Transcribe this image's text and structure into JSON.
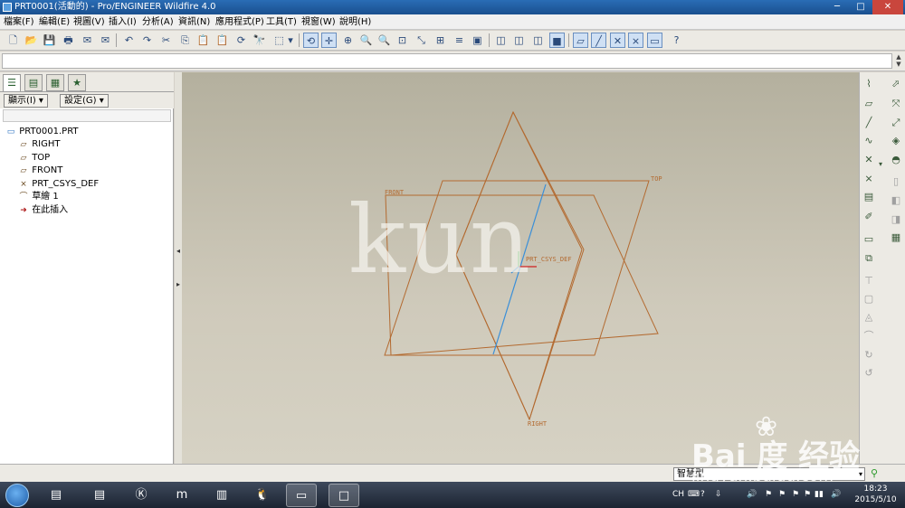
{
  "window": {
    "title": "PRT0001(活動的) - Pro/ENGINEER Wildfire 4.0"
  },
  "window_controls": {
    "minimize": "─",
    "maximize": "□",
    "close": "✕"
  },
  "menu": [
    {
      "label": "檔案(F)"
    },
    {
      "label": "編輯(E)"
    },
    {
      "label": "視圖(V)"
    },
    {
      "label": "插入(I)"
    },
    {
      "label": "分析(A)"
    },
    {
      "label": "資訊(N)"
    },
    {
      "label": "應用程式(P)"
    },
    {
      "label": "工具(T)"
    },
    {
      "label": "視窗(W)"
    },
    {
      "label": "說明(H)"
    }
  ],
  "toolbar": {
    "new": "🗋",
    "open": "📂",
    "save": "💾",
    "print": "🖶",
    "email": "✉",
    "email2": "✉",
    "undo": "↶",
    "redo": "↷",
    "cut": "✂",
    "copy": "⎘",
    "paste": "📋",
    "paste_special": "📋",
    "regenerate": "⟳",
    "find": "🔭",
    "select_box": "⬚",
    "dropdown": "▾",
    "repaint": "⟲",
    "spin_center": "✛",
    "orient": "⊕",
    "zoom_in": "🔍",
    "zoom_out": "🔍",
    "refit": "⊡",
    "reorient": "⤡",
    "saved_views": "⊞",
    "layers": "≡",
    "view_manager": "▣",
    "wireframe": "◫",
    "hidden_line": "◫",
    "no_hidden": "◫",
    "shading": "■",
    "datum_planes": "▱",
    "datum_axes": "╱",
    "datum_points": "✕",
    "coord_sys": "⨯",
    "annotations": "▭",
    "context_help": "?"
  },
  "message_area": {
    "scroll_up": "▲",
    "scroll_down": "▼"
  },
  "navigator": {
    "tabs": [
      "☰",
      "▤",
      "▦",
      "★"
    ],
    "show_button": "顯示(I) ▾",
    "settings_button": "設定(G) ▾",
    "tree": [
      {
        "label": "PRT0001.PRT",
        "icon": "▭"
      },
      {
        "label": "RIGHT",
        "icon": "▱"
      },
      {
        "label": "TOP",
        "icon": "▱"
      },
      {
        "label": "FRONT",
        "icon": "▱"
      },
      {
        "label": "PRT_CSYS_DEF",
        "icon": "⨯"
      },
      {
        "label": "草繪 1",
        "icon": "⌒"
      },
      {
        "label": "在此插入",
        "icon": "➜"
      }
    ]
  },
  "splitter": {
    "collapse": "◂",
    "expand": "▸"
  },
  "model": {
    "planes": [
      {
        "label": "TOP"
      },
      {
        "label": "FRONT"
      },
      {
        "label": "RIGHT"
      }
    ],
    "csys": {
      "label": "PRT_CSYS_DEF"
    },
    "colors": {
      "plane": "#b36a30",
      "sketch": "#3a8fd8",
      "csys_x": "#d02020",
      "csys_y": "#20a020"
    }
  },
  "right_toolbar": {
    "col1": [
      "⌇",
      "▱",
      "╱",
      "∿",
      "✕",
      "⨯",
      "▤",
      "✐",
      "▭",
      "⧉",
      "⊤",
      "▢",
      "◬",
      "⌒",
      "↻",
      "↺"
    ],
    "col2": [
      "⬀",
      "⤧",
      "⤢",
      "◈",
      "◓",
      "▯",
      "◧",
      "◨",
      "▦"
    ],
    "dropdown": "▾"
  },
  "statusbar": {
    "filter_value": "智慧型",
    "filter_dropdown": "▾",
    "regen_light": "⚲"
  },
  "taskbar": {
    "tasks": [
      "▤",
      "Ⓚ",
      "m",
      "▥",
      "🐧",
      "▭",
      "□"
    ],
    "tray": [
      "CH",
      "⌨",
      "?",
      "⇩",
      "🔊",
      "⚑",
      "⚑",
      "⚑",
      "⚑",
      "▮▮",
      "🔊"
    ],
    "clock_time": "18:23",
    "clock_date": "2015/5/10"
  },
  "watermark": {
    "kun": "kun",
    "baidu_brand": "Bai 度 经验",
    "baidu_site": "jingyan.baidu.com",
    "baidu_paw": "❀"
  }
}
